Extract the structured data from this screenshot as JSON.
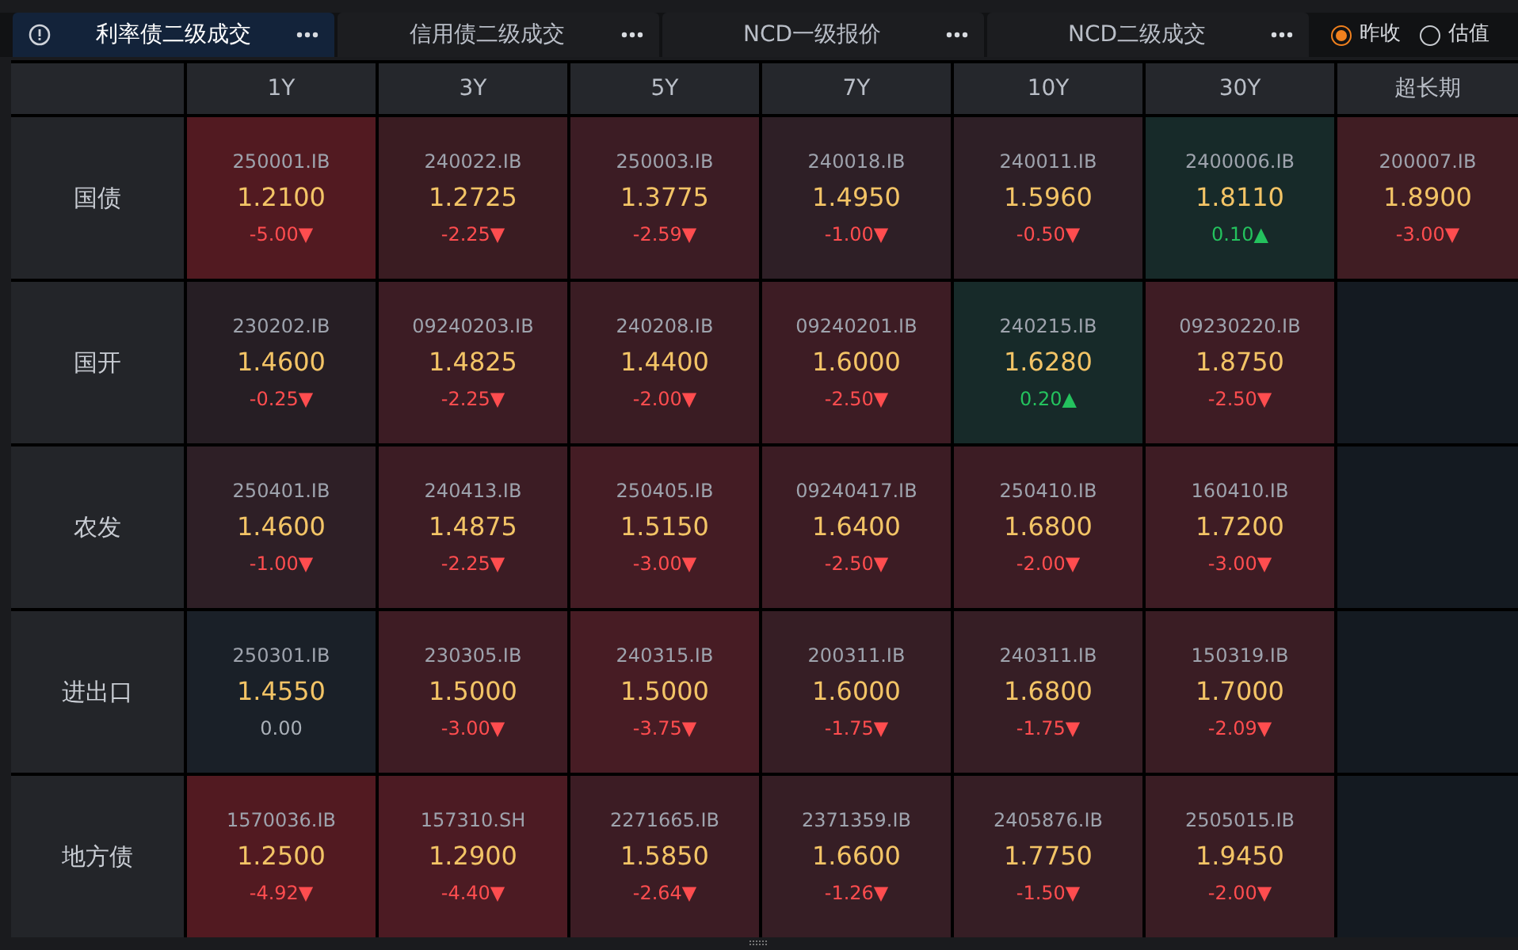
{
  "tabs": [
    {
      "label": "利率债二级成交",
      "selected": true,
      "info": true
    },
    {
      "label": "信用债二级成交",
      "selected": false
    },
    {
      "label": "NCD一级报价",
      "selected": false
    },
    {
      "label": "NCD二级成交",
      "selected": false
    }
  ],
  "price_basis": [
    {
      "label": "昨收",
      "selected": true
    },
    {
      "label": "估值",
      "selected": false
    }
  ],
  "columns": [
    "1Y",
    "3Y",
    "5Y",
    "7Y",
    "10Y",
    "30Y",
    "超长期"
  ],
  "rows": [
    {
      "label": "国债",
      "cells": [
        {
          "kind": "fall",
          "code": "250001.IB",
          "yield": "1.2100",
          "change": "-5.00▼",
          "color": "#521a21"
        },
        {
          "kind": "fall",
          "code": "240022.IB",
          "yield": "1.2725",
          "change": "-2.25▼",
          "color": "#3a1c22"
        },
        {
          "kind": "fall",
          "code": "250003.IB",
          "yield": "1.3775",
          "change": "-2.59▼",
          "color": "#3c1c24"
        },
        {
          "kind": "fall",
          "code": "240018.IB",
          "yield": "1.4950",
          "change": "-1.00▼",
          "color": "#2e1f26"
        },
        {
          "kind": "fall",
          "code": "240011.IB",
          "yield": "1.5960",
          "change": "-0.50▼",
          "color": "#2e1f26"
        },
        {
          "kind": "rise",
          "code": "2400006.IB",
          "yield": "1.8110",
          "change": "0.10▲",
          "color": "#172a29"
        },
        {
          "kind": "fall",
          "code": "200007.IB",
          "yield": "1.8900",
          "change": "-3.00▼",
          "color": "#401d23"
        }
      ]
    },
    {
      "label": "国开",
      "cells": [
        {
          "kind": "fall",
          "code": "230202.IB",
          "yield": "1.4600",
          "change": "-0.25▼",
          "color": "#261e24"
        },
        {
          "kind": "fall",
          "code": "09240203.IB",
          "yield": "1.4825",
          "change": "-2.25▼",
          "color": "#3c1c24"
        },
        {
          "kind": "fall",
          "code": "240208.IB",
          "yield": "1.4400",
          "change": "-2.00▼",
          "color": "#3a1c23"
        },
        {
          "kind": "fall",
          "code": "09240201.IB",
          "yield": "1.6000",
          "change": "-2.50▼",
          "color": "#3d1c24"
        },
        {
          "kind": "rise",
          "code": "240215.IB",
          "yield": "1.6280",
          "change": "0.20▲",
          "color": "#172a29"
        },
        {
          "kind": "fall",
          "code": "09230220.IB",
          "yield": "1.8750",
          "change": "-2.50▼",
          "color": "#3e1c24"
        },
        {
          "kind": "empty",
          "color": "#141a21"
        }
      ]
    },
    {
      "label": "农发",
      "cells": [
        {
          "kind": "fall",
          "code": "250401.IB",
          "yield": "1.4600",
          "change": "-1.00▼",
          "color": "#2e1f26"
        },
        {
          "kind": "fall",
          "code": "240413.IB",
          "yield": "1.4875",
          "change": "-2.25▼",
          "color": "#3c1c24"
        },
        {
          "kind": "fall",
          "code": "250405.IB",
          "yield": "1.5150",
          "change": "-3.00▼",
          "color": "#441c24"
        },
        {
          "kind": "fall",
          "code": "09240417.IB",
          "yield": "1.6400",
          "change": "-2.50▼",
          "color": "#3c1c24"
        },
        {
          "kind": "fall",
          "code": "250410.IB",
          "yield": "1.6800",
          "change": "-2.00▼",
          "color": "#3c1c24"
        },
        {
          "kind": "fall",
          "code": "160410.IB",
          "yield": "1.7200",
          "change": "-3.00▼",
          "color": "#3e1c24"
        },
        {
          "kind": "empty",
          "color": "#141a21"
        }
      ]
    },
    {
      "label": "进出口",
      "cells": [
        {
          "kind": "flat",
          "code": "250301.IB",
          "yield": "1.4550",
          "change": "0.00",
          "color": "#1a2028"
        },
        {
          "kind": "fall",
          "code": "230305.IB",
          "yield": "1.5000",
          "change": "-3.00▼",
          "color": "#3e1c24"
        },
        {
          "kind": "fall",
          "code": "240315.IB",
          "yield": "1.5000",
          "change": "-3.75▼",
          "color": "#471c24"
        },
        {
          "kind": "fall",
          "code": "200311.IB",
          "yield": "1.6000",
          "change": "-1.75▼",
          "color": "#361e25"
        },
        {
          "kind": "fall",
          "code": "240311.IB",
          "yield": "1.6800",
          "change": "-1.75▼",
          "color": "#361e25"
        },
        {
          "kind": "fall",
          "code": "150319.IB",
          "yield": "1.7000",
          "change": "-2.09▼",
          "color": "#3a1d24"
        },
        {
          "kind": "empty",
          "color": "#141a21"
        }
      ]
    },
    {
      "label": "地方债",
      "cells": [
        {
          "kind": "fall",
          "code": "1570036.IB",
          "yield": "1.2500",
          "change": "-4.92▼",
          "color": "#521a21"
        },
        {
          "kind": "fall",
          "code": "157310.SH",
          "yield": "1.2900",
          "change": "-4.40▼",
          "color": "#4c1b23"
        },
        {
          "kind": "fall",
          "code": "2271665.IB",
          "yield": "1.5850",
          "change": "-2.64▼",
          "color": "#3c1c24"
        },
        {
          "kind": "fall",
          "code": "2371359.IB",
          "yield": "1.6600",
          "change": "-1.26▼",
          "color": "#361e25"
        },
        {
          "kind": "fall",
          "code": "2405876.IB",
          "yield": "1.7750",
          "change": "-1.50▼",
          "color": "#361e25"
        },
        {
          "kind": "fall",
          "code": "2505015.IB",
          "yield": "1.9450",
          "change": "-2.00▼",
          "color": "#3a1d24"
        },
        {
          "kind": "empty",
          "color": "#141a21"
        }
      ]
    }
  ]
}
